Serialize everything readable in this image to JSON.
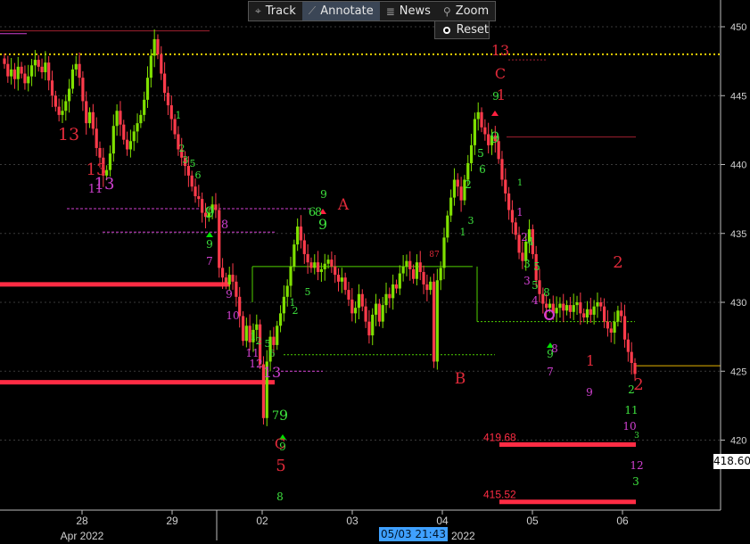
{
  "toolbar": {
    "track": {
      "label": "Track",
      "icon": "crosshair-icon"
    },
    "annotate": {
      "label": "Annotate",
      "icon": "pencil-icon",
      "active": true
    },
    "news": {
      "label": "News",
      "icon": "news-icon"
    },
    "zoom": {
      "label": "Zoom",
      "icon": "magnifier-icon"
    },
    "reset": {
      "label": "Reset"
    }
  },
  "crosshair_time": "05/03 21:43",
  "last_price_tag": "418.60",
  "chart_data": {
    "type": "candlestick",
    "y_ticks": [
      420,
      425,
      430,
      435,
      440,
      445,
      450
    ],
    "ylim": [
      416,
      451.5
    ],
    "x_labels": [
      "28",
      "29",
      "02",
      "03",
      "04",
      "05",
      "06"
    ],
    "x_sublabel": "Apr 2022",
    "x_end_label": "2022",
    "levels": [
      {
        "value": 448.0,
        "style": "dotted",
        "color": "#e6d000"
      },
      {
        "value": 419.68,
        "label": "419.68",
        "color": "#ff2c44"
      },
      {
        "value": 415.52,
        "label": "415.52",
        "color": "#ff2c44"
      },
      {
        "value": 425.4,
        "color": "#e6b400"
      },
      {
        "value": 431.3,
        "color": "#ff2c44"
      },
      {
        "value": 424.2,
        "color": "#ff2c44"
      }
    ],
    "colors": {
      "up": "#7fe000",
      "down": "#ff3b4b",
      "background": "#000000"
    },
    "closes": [
      447.3,
      446.4,
      446.9,
      446.2,
      447.1,
      446.6,
      445.9,
      446.4,
      447.2,
      447.6,
      447.1,
      446.7,
      447.4,
      446.1,
      445.0,
      444.2,
      443.6,
      443.9,
      444.6,
      445.5,
      446.9,
      447.3,
      446.3,
      444.6,
      443.0,
      443.8,
      442.6,
      441.2,
      440.5,
      439.2,
      439.6,
      440.8,
      442.8,
      443.9,
      442.9,
      441.8,
      441.1,
      441.7,
      442.4,
      443.0,
      443.6,
      444.7,
      446.3,
      447.9,
      449.1,
      448.0,
      446.6,
      445.2,
      444.3,
      443.3,
      442.2,
      441.1,
      440.5,
      439.9,
      439.2,
      438.4,
      437.7,
      437.5,
      436.5,
      436.2,
      436.5,
      437.1,
      436.7,
      432.5,
      431.8,
      431.3,
      432.0,
      431.5,
      430.4,
      429.0,
      427.2,
      428.3,
      427.1,
      428.0,
      428.4,
      425.5,
      421.6,
      425.7,
      427.5,
      426.9,
      428.3,
      429.2,
      430.4,
      431.2,
      432.6,
      434.2,
      435.5,
      434.5,
      433.5,
      432.9,
      432.5,
      432.9,
      432.2,
      432.4,
      432.8,
      433.1,
      432.6,
      432.0,
      431.5,
      431.8,
      430.9,
      430.2,
      429.2,
      429.6,
      430.6,
      429.7,
      428.6,
      427.6,
      429.1,
      429.9,
      428.6,
      429.8,
      430.6,
      430.3,
      431.3,
      431.0,
      432.1,
      432.6,
      433.0,
      432.4,
      431.7,
      432.9,
      432.2,
      431.3,
      430.9,
      431.5,
      425.7,
      431.6,
      432.5,
      434.7,
      436.3,
      437.6,
      438.9,
      438.4,
      437.4,
      438.9,
      440.1,
      441.4,
      443.3,
      443.8,
      442.7,
      442.2,
      441.4,
      442.1,
      441.7,
      440.4,
      438.9,
      437.9,
      436.7,
      435.8,
      434.9,
      433.6,
      433.0,
      434.4,
      435.3,
      433.5,
      431.6,
      430.6,
      429.9,
      429.6,
      429.9,
      429.2,
      429.6,
      429.9,
      429.4,
      429.8,
      429.3,
      429.8,
      430.0,
      429.2,
      428.9,
      429.5,
      429.1,
      429.7,
      430.0,
      429.7,
      428.6,
      428.1,
      427.8,
      428.6,
      429.4,
      429.0,
      427.3,
      426.4,
      425.6,
      424.8
    ]
  },
  "annotations": [
    {
      "t": "13",
      "c": "red",
      "x": 77,
      "y": 157,
      "s": 19
    },
    {
      "t": "13",
      "c": "red",
      "x": 108,
      "y": 196,
      "s": 18
    },
    {
      "t": "11",
      "c": "mag",
      "x": 107,
      "y": 216,
      "s": 13
    },
    {
      "t": "13",
      "c": "mag",
      "x": 117,
      "y": 212,
      "s": 18
    },
    {
      "t": "1",
      "c": "grn",
      "x": 200,
      "y": 133,
      "s": 11
    },
    {
      "t": "2",
      "c": "grn",
      "x": 204,
      "y": 170,
      "s": 11
    },
    {
      "t": "3",
      "c": "grn",
      "x": 208,
      "y": 183,
      "s": 11
    },
    {
      "t": "5",
      "c": "grn",
      "x": 216,
      "y": 187,
      "s": 11
    },
    {
      "t": "6",
      "c": "grn",
      "x": 222,
      "y": 200,
      "s": 11
    },
    {
      "t": "9",
      "c": "grn",
      "x": 235,
      "y": 244,
      "s": 17
    },
    {
      "t": "9",
      "c": "grn",
      "x": 235,
      "y": 278,
      "s": 12
    },
    {
      "t": "7",
      "c": "mag",
      "x": 235,
      "y": 297,
      "s": 12
    },
    {
      "t": "8",
      "c": "mag",
      "x": 252,
      "y": 256,
      "s": 13
    },
    {
      "t": "9",
      "c": "mag",
      "x": 257,
      "y": 334,
      "s": 12
    },
    {
      "t": "10",
      "c": "mag",
      "x": 261,
      "y": 358,
      "s": 12
    },
    {
      "t": "1",
      "c": "grn",
      "x": 284,
      "y": 381,
      "s": 11
    },
    {
      "t": "2",
      "c": "grn",
      "x": 290,
      "y": 386,
      "s": 11
    },
    {
      "t": "5",
      "c": "grn",
      "x": 300,
      "y": 389,
      "s": 11
    },
    {
      "t": "6",
      "c": "grn",
      "x": 305,
      "y": 400,
      "s": 11
    },
    {
      "t": "11",
      "c": "mag",
      "x": 283,
      "y": 400,
      "s": 12
    },
    {
      "t": "12",
      "c": "mag",
      "x": 287,
      "y": 412,
      "s": 12
    },
    {
      "t": "13",
      "c": "mag",
      "x": 305,
      "y": 423,
      "s": 16
    },
    {
      "t": "7",
      "c": "grn",
      "x": 309,
      "y": 470,
      "s": 13
    },
    {
      "t": "9",
      "c": "grn",
      "x": 318,
      "y": 471,
      "s": 16
    },
    {
      "t": "9",
      "c": "grn",
      "x": 317,
      "y": 505,
      "s": 12
    },
    {
      "t": "C",
      "c": "red",
      "x": 314,
      "y": 503,
      "s": 16
    },
    {
      "t": "5",
      "c": "red",
      "x": 315,
      "y": 528,
      "s": 18
    },
    {
      "t": "8",
      "c": "grn",
      "x": 314,
      "y": 561,
      "s": 12
    },
    {
      "t": "1",
      "c": "grn",
      "x": 328,
      "y": 343,
      "s": 11
    },
    {
      "t": "2",
      "c": "grn",
      "x": 331,
      "y": 352,
      "s": 11
    },
    {
      "t": "5",
      "c": "grn",
      "x": 345,
      "y": 331,
      "s": 11
    },
    {
      "t": "6",
      "c": "grn",
      "x": 350,
      "y": 242,
      "s": 13
    },
    {
      "t": "8",
      "c": "grn",
      "x": 357,
      "y": 242,
      "s": 13
    },
    {
      "t": "9",
      "c": "grn",
      "x": 363,
      "y": 222,
      "s": 12
    },
    {
      "t": "9",
      "c": "grn",
      "x": 362,
      "y": 257,
      "s": 16
    },
    {
      "t": "A",
      "c": "red",
      "x": 385,
      "y": 235,
      "s": 17
    },
    {
      "t": "B",
      "c": "red",
      "x": 516,
      "y": 430,
      "s": 17
    },
    {
      "t": "87",
      "c": "red",
      "x": 487,
      "y": 288,
      "s": 9
    },
    {
      "t": "1",
      "c": "grn",
      "x": 519,
      "y": 264,
      "s": 11
    },
    {
      "t": "3",
      "c": "grn",
      "x": 528,
      "y": 251,
      "s": 11
    },
    {
      "t": "2",
      "c": "grn",
      "x": 525,
      "y": 211,
      "s": 12
    },
    {
      "t": "5",
      "c": "grn",
      "x": 539,
      "y": 176,
      "s": 12
    },
    {
      "t": "6",
      "c": "grn",
      "x": 541,
      "y": 194,
      "s": 12
    },
    {
      "t": "9",
      "c": "grn",
      "x": 555,
      "y": 160,
      "s": 17
    },
    {
      "t": "9",
      "c": "grn",
      "x": 556,
      "y": 112,
      "s": 12
    },
    {
      "t": "1",
      "c": "red",
      "x": 562,
      "y": 112,
      "s": 16
    },
    {
      "t": "13",
      "c": "red",
      "x": 561,
      "y": 62,
      "s": 16
    },
    {
      "t": "C",
      "c": "red",
      "x": 561,
      "y": 88,
      "s": 16
    },
    {
      "t": "1",
      "c": "grn",
      "x": 583,
      "y": 208,
      "s": 10
    },
    {
      "t": "1",
      "c": "mag",
      "x": 583,
      "y": 242,
      "s": 12
    },
    {
      "t": "2",
      "c": "mag",
      "x": 588,
      "y": 270,
      "s": 12
    },
    {
      "t": "4",
      "c": "grn",
      "x": 595,
      "y": 275,
      "s": 12
    },
    {
      "t": "3",
      "c": "grn",
      "x": 591,
      "y": 300,
      "s": 12
    },
    {
      "t": "5",
      "c": "grn",
      "x": 602,
      "y": 303,
      "s": 12
    },
    {
      "t": "3",
      "c": "mag",
      "x": 591,
      "y": 319,
      "s": 12
    },
    {
      "t": "5",
      "c": "grn",
      "x": 600,
      "y": 324,
      "s": 12
    },
    {
      "t": "8",
      "c": "grn",
      "x": 613,
      "y": 332,
      "s": 12
    },
    {
      "t": "4",
      "c": "mag",
      "x": 600,
      "y": 341,
      "s": 12
    },
    {
      "t": "9",
      "c": "grn",
      "x": 617,
      "y": 401,
      "s": 12
    },
    {
      "t": "8",
      "c": "mag",
      "x": 622,
      "y": 395,
      "s": 12
    },
    {
      "t": "7",
      "c": "mag",
      "x": 617,
      "y": 421,
      "s": 12
    },
    {
      "t": "1",
      "c": "red",
      "x": 662,
      "y": 410,
      "s": 16
    },
    {
      "t": "9",
      "c": "mag",
      "x": 661,
      "y": 444,
      "s": 12
    },
    {
      "t": "2",
      "c": "red",
      "x": 693,
      "y": 300,
      "s": 18
    },
    {
      "t": "2",
      "c": "grn",
      "x": 708,
      "y": 441,
      "s": 12
    },
    {
      "t": "2",
      "c": "red",
      "x": 716,
      "y": 437,
      "s": 18
    },
    {
      "t": "11",
      "c": "grn",
      "x": 708,
      "y": 464,
      "s": 12
    },
    {
      "t": "10",
      "c": "mag",
      "x": 706,
      "y": 482,
      "s": 12
    },
    {
      "t": "3",
      "c": "grn",
      "x": 714,
      "y": 491,
      "s": 9
    },
    {
      "t": "12",
      "c": "mag",
      "x": 714,
      "y": 526,
      "s": 12
    },
    {
      "t": "3",
      "c": "grn",
      "x": 713,
      "y": 544,
      "s": 12
    }
  ]
}
